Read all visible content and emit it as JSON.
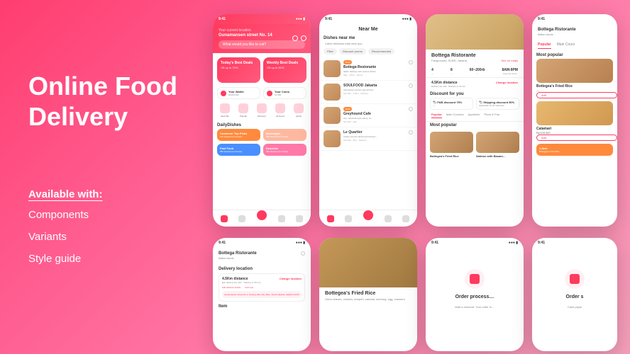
{
  "hero": {
    "title_line1": "Online Food",
    "title_line2": "Delivery",
    "available_label": "Available with:",
    "features": [
      "Components",
      "Variants",
      "Style guide"
    ]
  },
  "mock_home": {
    "status_time": "9:41",
    "location_hint": "Your current location",
    "location": "Gunamansen street No. 14",
    "search_placeholder": "What would you like to eat?",
    "deal1_title": "Today's Best Deals",
    "deal1_sub": "Off up to 70%",
    "deal2_title": "Weekly Best Deals",
    "deal2_sub": "Off up to 50%",
    "wallet1": "Your Wallet",
    "wallet1_sub": "Rp100.000",
    "wallet2": "Your Coins",
    "wallet2_sub": "12.000",
    "categories": [
      "Near Me",
      "Popular",
      "Discount",
      "24 Hours",
      "Quick"
    ],
    "section_dailydishes": "DailyDishes",
    "daily": [
      {
        "title": "Customer Top Picks",
        "sub": "523 Restaurant Already"
      },
      {
        "title": "Beverages",
        "sub": "988 Restaurant Already"
      },
      {
        "title": "Fast Food",
        "sub": "882 Restaurant Already"
      },
      {
        "title": "Desserts",
        "sub": "469 Restaurant Already"
      }
    ]
  },
  "mock_nearme": {
    "title": "Near Me",
    "header": "Dishes near me",
    "sub": "Catch delicious eats near you",
    "filters": [
      "Filter",
      "Discount promo",
      "Recommended"
    ],
    "badge_deal": "Deal",
    "restaurants": [
      {
        "name": "Bottega Restorante",
        "desc": "Italian delicacy with various dishes",
        "meta": "Italy · 2.5km · 20min"
      },
      {
        "name": "SOULFOOD Jakarta",
        "desc": "Indonesian comfort sets arrived…",
        "meta": "Set dish · 3.6km · Delivery"
      },
      {
        "name": "Greyhound Cafe",
        "desc": "Hip, industrial-style eatery, wi…",
        "meta": "Set dish · 4km"
      },
      {
        "name": "Le Quartier",
        "desc": "Classy French-influenced brasseri…",
        "meta": "Set dish · 5km · Delivery"
      }
    ]
  },
  "mock_restaurant": {
    "name": "Bottega Ristorante",
    "cuisine": "—",
    "location": "Fairgrounds, SCBD, Jakarta",
    "see_maps": "See on maps",
    "stats": [
      {
        "v": "4",
        "l": "—"
      },
      {
        "v": "8",
        "l": "—"
      },
      {
        "v": "60~200rb",
        "l": "—"
      },
      {
        "v": "8AM-9PM",
        "l": "Opening hours"
      }
    ],
    "distance": "4.5Km distance",
    "distance_sub": "Delivery fee 12k · Delivery in 19 min",
    "change_loc": "Change location",
    "discount_title": "Discount for you",
    "discounts": [
      {
        "title": "F&B discount 75%",
        "sub": "—"
      },
      {
        "title": "Shipping discount 50%",
        "sub": "Applicable for all meal sets"
      }
    ],
    "tabs": [
      "Popular",
      "Main Courses",
      "Appetizer",
      "Pizza & Pas"
    ],
    "most_popular": "Most popular",
    "dishes": [
      "Bottegea's Fried Rice",
      "Salmon with Basam…"
    ]
  },
  "mock_menu": {
    "name": "Bottega Ristorante",
    "cuisine": "Italian foods",
    "tabs": [
      "Popular",
      "Main Cours"
    ],
    "most_popular": "Most popular",
    "dish1_name": "Bottegea's Fried Rice",
    "dish1_price": "—",
    "add_label": "Add",
    "dish2_name": "Calamari",
    "dish2_price": "Rp128.300",
    "cart_title": "1 Item",
    "cart_sub": "Bottegea's Fried Rice"
  },
  "mock_delivery": {
    "name": "Bottega Ristorante",
    "cuisine": "Italian foods",
    "section": "Delivery location",
    "distance": "4.5Km distance",
    "distance_sub": "Est. delivery fee 12m · Delivery in 15 min",
    "change_loc": "Change location",
    "edit_addr": "Edit address details",
    "add_note": "Add note",
    "address": "Gunamansen street No.3, Setang, Bar, Ally, Baru, South Jakarta, Jakarta 12210",
    "item_label": "Item"
  },
  "mock_food_detail": {
    "title": "Bottegea's Fried Rice",
    "desc": "Onion leaves, chicken, tempeh, sambal, sunhorg, egg, crackers"
  },
  "mock_order": {
    "title": "Order process…",
    "sub": "Wait a moment. Your order is…"
  },
  "mock_order2": {
    "title": "Order s",
    "sub_label": "Cash paym"
  }
}
